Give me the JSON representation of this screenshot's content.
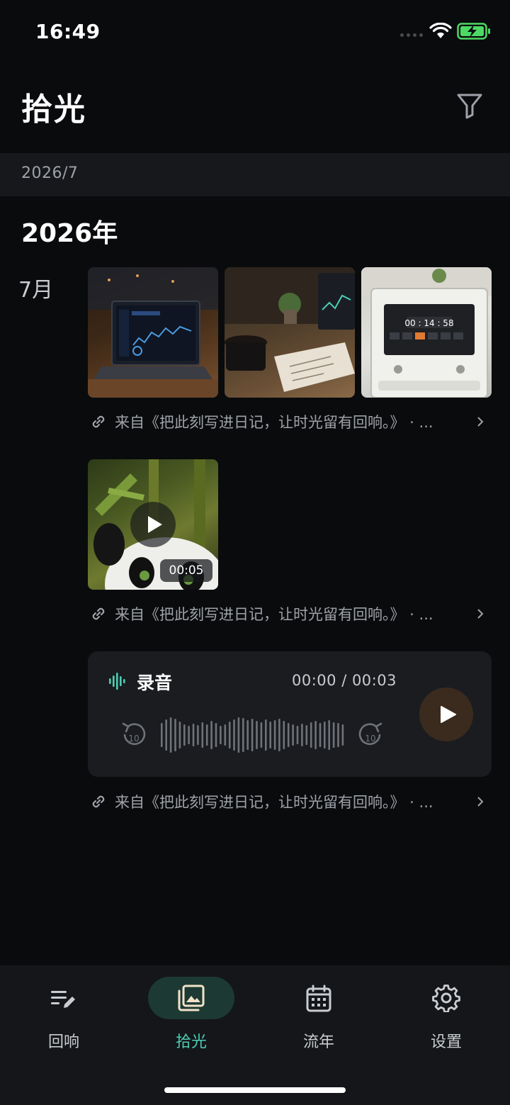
{
  "status_bar": {
    "time": "16:49"
  },
  "header": {
    "title": "拾光"
  },
  "month_band": "2026/7",
  "timeline": {
    "year": "2026年",
    "month": "7月",
    "entries": [
      {
        "type": "photos",
        "source": "来自《把此刻写进日记，让时光留有回响。》 · ..."
      },
      {
        "type": "video",
        "duration": "00:05",
        "source": "来自《把此刻写进日记，让时光留有回响。》 · ..."
      },
      {
        "type": "audio",
        "title": "录音",
        "time": "00:00 / 00:03",
        "source": "来自《把此刻写进日记，让时光留有回响。》 · ..."
      }
    ]
  },
  "tabbar": {
    "items": [
      {
        "label": "回响",
        "icon": "edit-notes-icon",
        "active": false
      },
      {
        "label": "拾光",
        "icon": "photo-library-icon",
        "active": true
      },
      {
        "label": "流年",
        "icon": "calendar-icon",
        "active": false
      },
      {
        "label": "设置",
        "icon": "gear-icon",
        "active": false
      }
    ]
  },
  "colors": {
    "background": "#0a0b0d",
    "accent": "#4ecdb5",
    "battery": "#4cd964",
    "card": "#1a1c20"
  }
}
